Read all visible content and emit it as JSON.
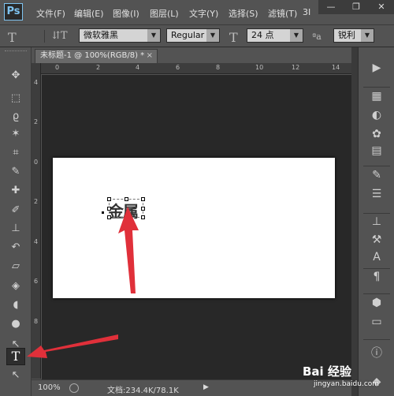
{
  "app": {
    "logo": "Ps"
  },
  "menu": [
    {
      "label": "文件(F)"
    },
    {
      "label": "编辑(E)"
    },
    {
      "label": "图像(I)"
    },
    {
      "label": "图层(L)"
    },
    {
      "label": "文字(Y)"
    },
    {
      "label": "选择(S)"
    },
    {
      "label": "滤镜(T)"
    },
    {
      "label": "3I"
    }
  ],
  "window_controls": {
    "minimize": "—",
    "restore": "❐",
    "close": "✕"
  },
  "options": {
    "tool_icon": "T",
    "orient_icon": "⇵T",
    "font_family": "微软雅黑",
    "font_style": "Regular",
    "size_icon": "T",
    "font_size": "24 点",
    "aa_icon": "ªa",
    "anti_alias": "锐利"
  },
  "document": {
    "tab_title": "未标题-1 @ 100%(RGB/8) *",
    "tab_close": "×",
    "text_layer_content": "金属",
    "ruler_h": [
      "0",
      "2",
      "4",
      "6",
      "8",
      "10",
      "12",
      "14"
    ],
    "ruler_v": [
      "4",
      "2",
      "0",
      "2",
      "4",
      "6",
      "8"
    ]
  },
  "tools": [
    {
      "name": "move-tool",
      "icon": "✥"
    },
    {
      "name": "marquee-tool",
      "icon": "⬚"
    },
    {
      "name": "lasso-tool",
      "icon": "ϱ"
    },
    {
      "name": "magic-wand-tool",
      "icon": "✶"
    },
    {
      "name": "crop-tool",
      "icon": "⌗"
    },
    {
      "name": "eyedropper-tool",
      "icon": "✎"
    },
    {
      "name": "healing-brush-tool",
      "icon": "✚"
    },
    {
      "name": "brush-tool",
      "icon": "✐"
    },
    {
      "name": "clone-stamp-tool",
      "icon": "⊥"
    },
    {
      "name": "history-brush-tool",
      "icon": "↶"
    },
    {
      "name": "eraser-tool",
      "icon": "▱"
    },
    {
      "name": "paint-bucket-tool",
      "icon": "◈"
    },
    {
      "name": "blur-tool",
      "icon": "◖"
    },
    {
      "name": "dodge-tool",
      "icon": "●"
    },
    {
      "name": "path-selection-tool",
      "icon": "↖"
    },
    {
      "name": "type-tool",
      "icon": "T"
    },
    {
      "name": "direct-selection-tool",
      "icon": "↖"
    }
  ],
  "status": {
    "zoom": "100%",
    "doc_info": "文档:234.4K/78.1K",
    "arrow": "▶"
  },
  "right_panel": [
    {
      "name": "play-icon",
      "icon": "▶"
    },
    {
      "name": "swatches-icon",
      "icon": "▦"
    },
    {
      "name": "adjustments-icon",
      "icon": "◐"
    },
    {
      "name": "palette-icon",
      "icon": "✿"
    },
    {
      "name": "grid-icon",
      "icon": "▤"
    },
    {
      "name": "brush-panel-icon",
      "icon": "✎"
    },
    {
      "name": "levels-icon",
      "icon": "☰"
    },
    {
      "name": "stamp-panel-icon",
      "icon": "⊥"
    },
    {
      "name": "tools-preset-icon",
      "icon": "⚒"
    },
    {
      "name": "character-icon",
      "icon": "A"
    },
    {
      "name": "paragraph-icon",
      "icon": "¶"
    },
    {
      "name": "3d-icon",
      "icon": "⬢"
    },
    {
      "name": "layer-comps-icon",
      "icon": "▭"
    },
    {
      "name": "info-icon",
      "icon": "ⓘ"
    },
    {
      "name": "layers-icon",
      "icon": "◆"
    }
  ],
  "watermark": {
    "logo": "Bai 经验",
    "url": "jingyan.baidu.com"
  },
  "colors": {
    "annotation_red": "#e0303a",
    "panel_bg": "#535353",
    "canvas_bg": "#282828"
  }
}
